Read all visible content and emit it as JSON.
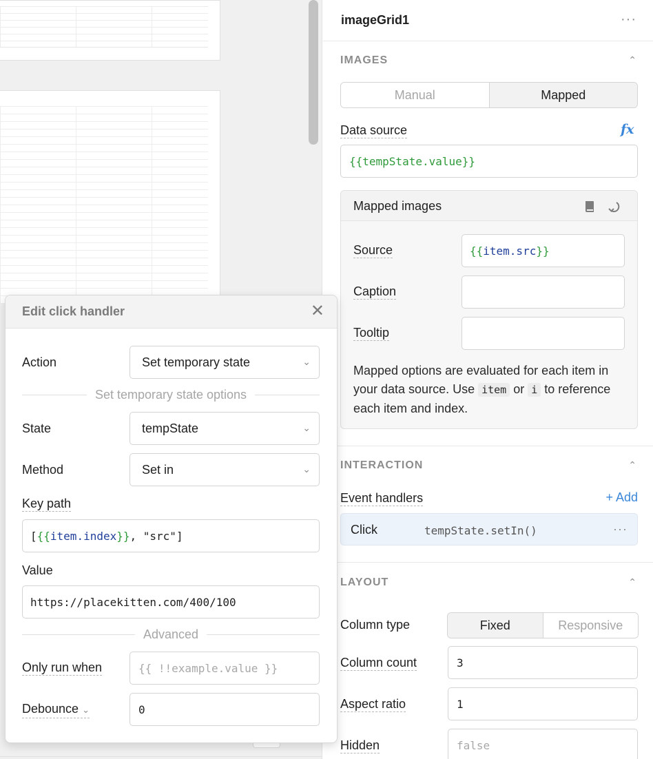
{
  "inspector": {
    "title": "imageGrid1",
    "more_icon": "more-dots-icon",
    "images_section": {
      "heading": "IMAGES",
      "mode_tabs": [
        {
          "label": "Manual",
          "active": false
        },
        {
          "label": "Mapped",
          "active": true
        }
      ],
      "data_source_label": "Data source",
      "data_source_value": {
        "open": "{{",
        "expr": "tempState.value",
        "close": "}}"
      },
      "mapped": {
        "title": "Mapped images",
        "source_label": "Source",
        "source_value": {
          "open": "{{",
          "expr": "item.src",
          "close": "}}"
        },
        "caption_label": "Caption",
        "tooltip_label": "Tooltip",
        "help": {
          "part1": "Mapped options are evaluated for each item in your data source. Use ",
          "chip1": "item",
          "part2": " or ",
          "chip2": "i",
          "part3": " to reference each item and index."
        }
      }
    },
    "interaction_section": {
      "heading": "INTERACTION",
      "event_handlers_label": "Event handlers",
      "add_label": "+ Add",
      "handlers": [
        {
          "event": "Click",
          "action": "tempState.setIn()"
        }
      ]
    },
    "layout_section": {
      "heading": "LAYOUT",
      "column_type_label": "Column type",
      "column_type_tabs": [
        {
          "label": "Fixed",
          "active": true
        },
        {
          "label": "Responsive",
          "active": false
        }
      ],
      "column_count_label": "Column count",
      "column_count_value": "3",
      "aspect_ratio_label": "Aspect ratio",
      "aspect_ratio_value": "1",
      "hidden_label": "Hidden",
      "hidden_placeholder": "false"
    }
  },
  "modal": {
    "title": "Edit click handler",
    "action_label": "Action",
    "action_value": "Set temporary state",
    "options_separator": "Set temporary state options",
    "state_label": "State",
    "state_value": "tempState",
    "method_label": "Method",
    "method_value": "Set in",
    "key_path_label": "Key path",
    "key_path": {
      "open_bracket": "[",
      "open": "{{",
      "expr": "item.index",
      "close": "}}",
      "rest": ", \"src\"",
      "close_bracket": "]"
    },
    "value_label": "Value",
    "value_value": "https://placekitten.com/400/100",
    "advanced_separator": "Advanced",
    "only_run_when_label": "Only run when",
    "only_run_when_placeholder": "{{ !!example.value }}",
    "debounce_label": "Debounce",
    "debounce_value": "0"
  },
  "colors": {
    "accent": "#3a87d9",
    "template_brace": "#2f9a3a",
    "template_expr": "#21409a",
    "handler_row_bg": "#edf3fb"
  }
}
